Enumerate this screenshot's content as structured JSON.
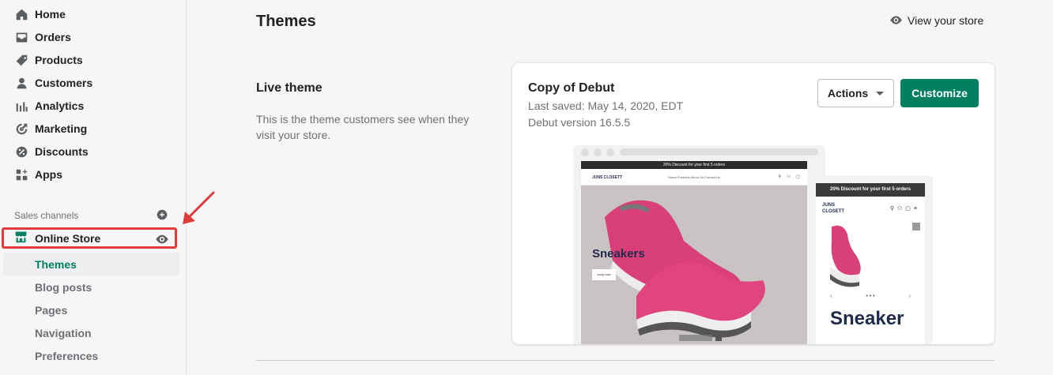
{
  "sidebar": {
    "nav": [
      {
        "label": "Home",
        "icon": "home-icon"
      },
      {
        "label": "Orders",
        "icon": "orders-icon"
      },
      {
        "label": "Products",
        "icon": "tag-icon"
      },
      {
        "label": "Customers",
        "icon": "person-icon"
      },
      {
        "label": "Analytics",
        "icon": "bar-chart-icon"
      },
      {
        "label": "Marketing",
        "icon": "target-icon"
      },
      {
        "label": "Discounts",
        "icon": "discount-icon"
      },
      {
        "label": "Apps",
        "icon": "apps-icon"
      }
    ],
    "sales_channels_label": "Sales channels",
    "online_store": {
      "label": "Online Store"
    },
    "sub_items": [
      {
        "label": "Themes",
        "active": true
      },
      {
        "label": "Blog posts"
      },
      {
        "label": "Pages"
      },
      {
        "label": "Navigation"
      },
      {
        "label": "Preferences"
      }
    ]
  },
  "header": {
    "title": "Themes",
    "view_store": "View your store"
  },
  "live_theme": {
    "heading": "Live theme",
    "description": "This is the theme customers see when they visit your store."
  },
  "theme_card": {
    "name": "Copy of Debut",
    "last_saved": "Last saved: May 14, 2020, EDT",
    "version": "Debut version 16.5.5",
    "actions_label": "Actions",
    "customize_label": "Customize"
  },
  "preview": {
    "promo": "20% Discount for your first 5 orders",
    "brand": "JUNS CLOSETT",
    "menu": "Home   Products   About Us   Contact Us",
    "hero_text": "Sneakers",
    "shop_button": "shop now",
    "mobile_hero_text": "Sneaker"
  },
  "colors": {
    "accent": "#008060",
    "annotation": "#e03c3c"
  }
}
